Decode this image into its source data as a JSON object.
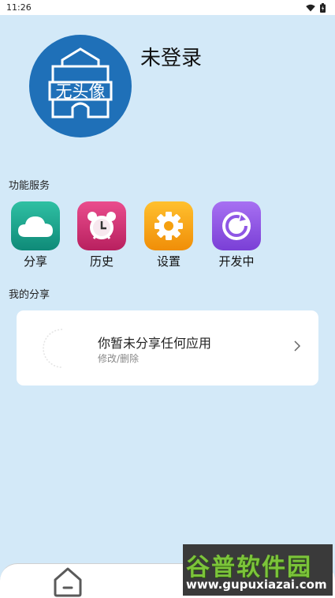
{
  "status_bar": {
    "time": "11:26",
    "icons": [
      "wifi-icon",
      "battery-icon"
    ]
  },
  "profile": {
    "avatar_text": "无头像",
    "login_status": "未登录"
  },
  "services": {
    "title": "功能服务",
    "items": [
      {
        "label": "分享",
        "icon": "cloud-icon",
        "color": "#1a9b86"
      },
      {
        "label": "历史",
        "icon": "alarm-clock-icon",
        "color": "#d8357a"
      },
      {
        "label": "设置",
        "icon": "gear-icon",
        "color": "#f6a413"
      },
      {
        "label": "开发中",
        "icon": "refresh-icon",
        "color": "#8f57e5"
      }
    ]
  },
  "my_shares": {
    "title": "我的分享",
    "card_title": "你暂未分享任何应用",
    "card_subtitle": "修改/删除"
  },
  "bottom_nav": {
    "home_icon": "home-icon"
  },
  "watermark": {
    "title": "谷普软件园",
    "url": "www.gupuxiazai.com"
  },
  "colors": {
    "background": "#d3e9f8",
    "avatar": "#1f70b8",
    "card": "#ffffff"
  }
}
